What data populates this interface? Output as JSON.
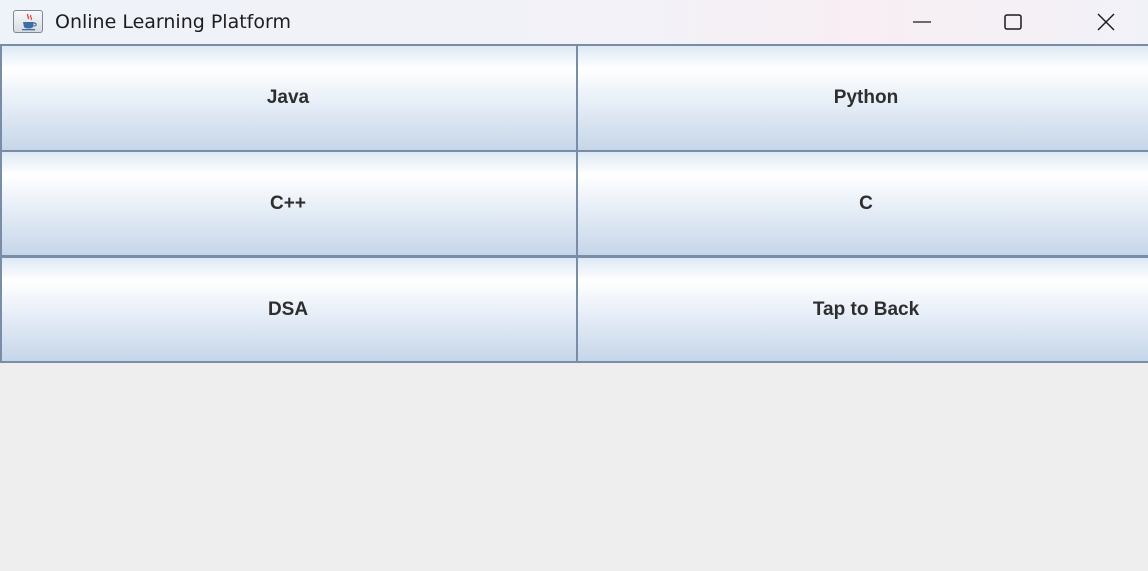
{
  "window": {
    "title": "Online Learning Platform",
    "icon": "java-coffee-cup-icon",
    "controls": [
      "minimize-icon",
      "maximize-icon",
      "close-icon"
    ]
  },
  "buttons": [
    {
      "label": "Java"
    },
    {
      "label": "Python"
    },
    {
      "label": "C++"
    },
    {
      "label": "C"
    },
    {
      "label": "DSA"
    },
    {
      "label": "Tap to Back"
    }
  ],
  "colors": {
    "border": "#7a8da6",
    "content_background": "#eeeeee",
    "button_text": "#2e2e2e"
  }
}
